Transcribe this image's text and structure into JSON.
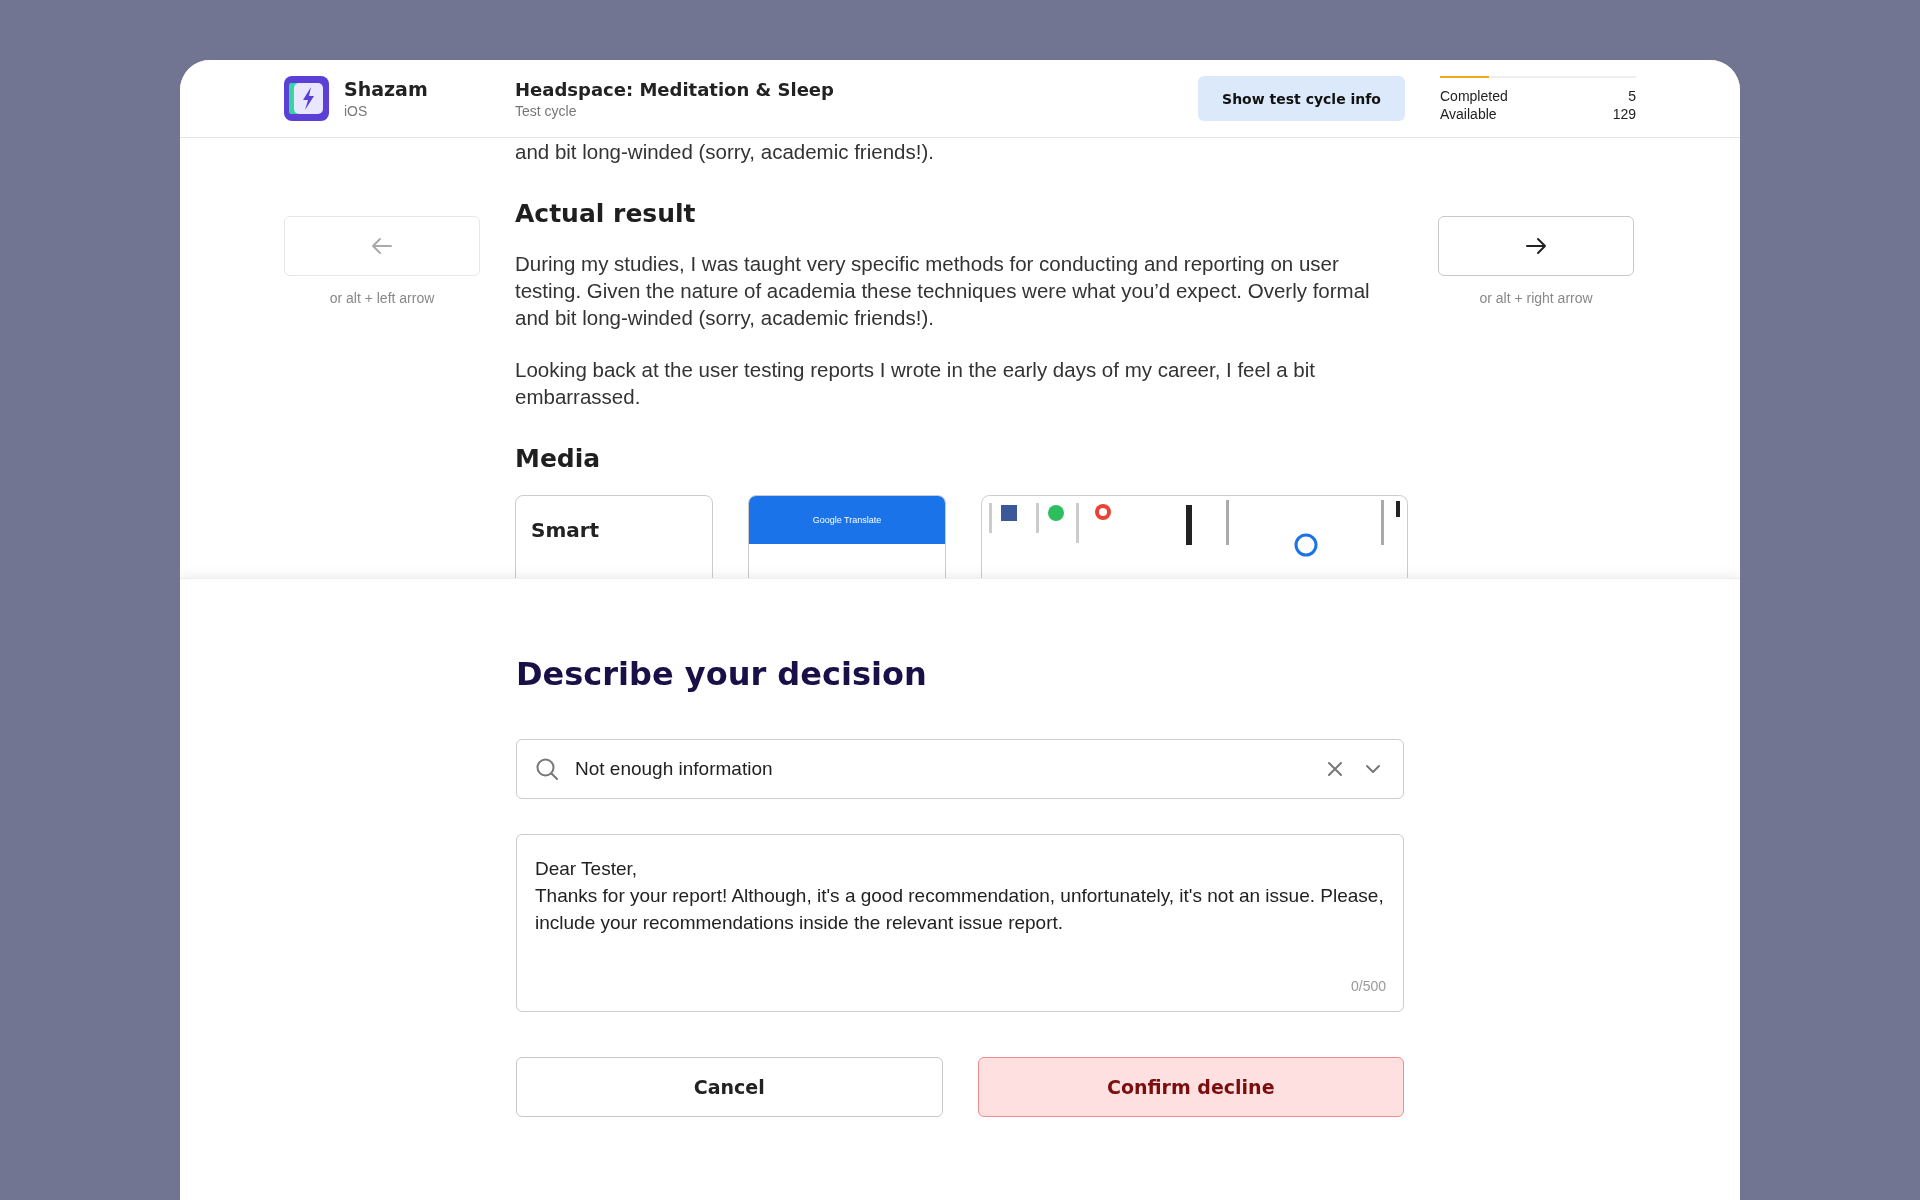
{
  "app": {
    "name": "Shazam",
    "platform": "iOS"
  },
  "test_cycle": {
    "title": "Headspace: Meditation & Sleep",
    "subtitle": "Test cycle"
  },
  "info_button": "Show test cycle info",
  "stats": {
    "level": 0.25,
    "items": [
      {
        "label": "Completed",
        "value": "5"
      },
      {
        "label": "Available",
        "value": "129"
      }
    ]
  },
  "nav": [
    {
      "kind": "previous",
      "hint": "or alt + left arrow",
      "disabled": true
    },
    {
      "kind": "next",
      "hint": "or alt + right arrow",
      "disabled": false
    }
  ],
  "report": {
    "cut_line": "and bit long-winded (sorry, academic friends!).",
    "sections": [
      {
        "heading": "Actual result",
        "paragraphs": [
          "During my studies, I was taught very specific methods for conducting and reporting on user testing. Given the nature of academia these techniques were what you’d expect. Overly formal and bit long-winded (sorry, academic friends!).",
          "Looking back at the user testing reports I wrote in the early days of my career, I feel a bit embarrassed."
        ]
      },
      {
        "heading": "Media",
        "media": [
          {
            "kind": "card",
            "title": "Smart"
          },
          {
            "kind": "app_screen",
            "header": "Google Translate"
          },
          {
            "kind": "picture"
          }
        ]
      }
    ]
  },
  "decision": {
    "title": "Describe your decision",
    "reason": {
      "value": "Not enough information"
    },
    "message": {
      "value": "Dear Tester,\nThanks for your report! Although, it's a good recommendation, unfortunately, it's not an issue. Please, include your recommendations inside the relevant issue report.",
      "counter": "0/500"
    },
    "buttons": [
      {
        "label": "Cancel",
        "kind": "secondary"
      },
      {
        "label": "Confirm decline",
        "kind": "danger"
      }
    ]
  }
}
